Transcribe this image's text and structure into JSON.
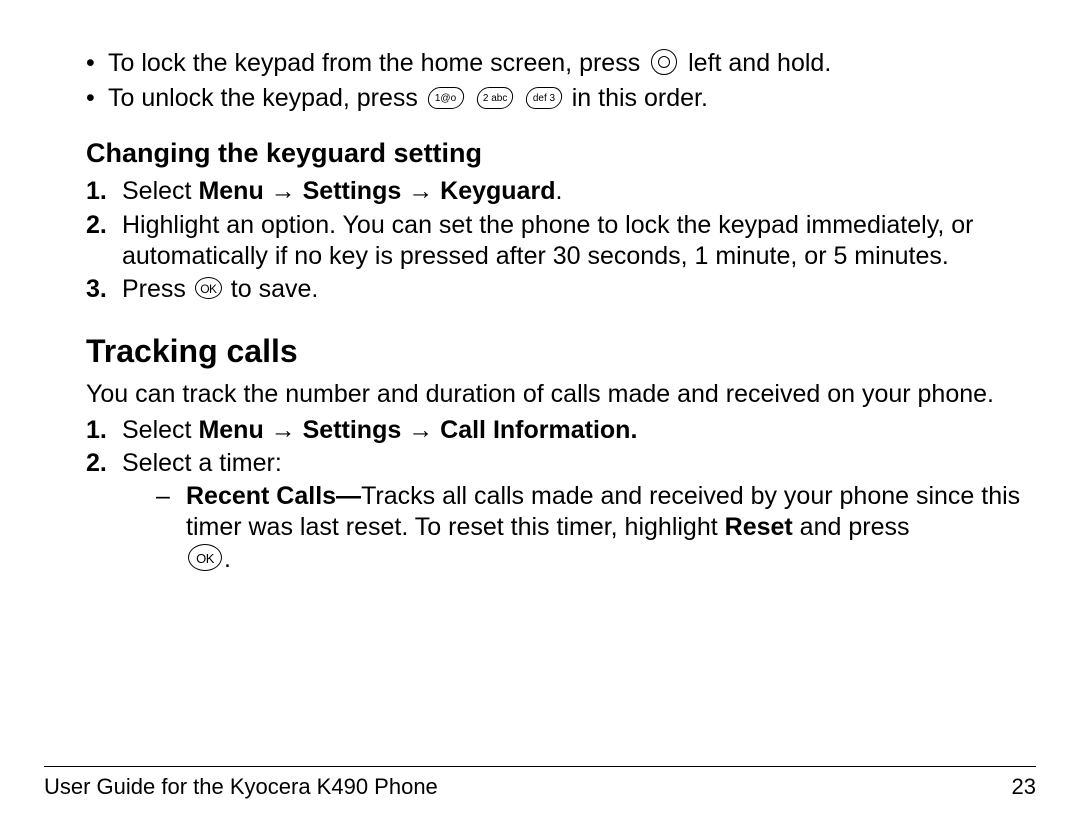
{
  "bullet1_a": "To lock the keypad from the home screen, press ",
  "bullet1_b": " left and hold.",
  "bullet2_a": "To unlock the keypad, press ",
  "bullet2_b": " in this order.",
  "key1_label": "1@o",
  "key2_label": "2 abc",
  "key3_label": "def 3",
  "heading_keyguard": "Changing the keyguard setting",
  "kg_step1_a": "Select ",
  "kg_step1_b": "Menu",
  "kg_step1_c": "Settings",
  "kg_step1_d": "Keyguard",
  "arrow": " → ",
  "period": ".",
  "kg_step2": "Highlight an option. You can set the phone to lock the keypad immediately, or automatically if no key is pressed after 30 seconds, 1 minute, or 5 minutes.",
  "kg_step3_a": "Press ",
  "kg_step3_b": " to save.",
  "ok_label": "OK",
  "heading_tracking": "Tracking calls",
  "tracking_body": "You can track the number and duration of calls made and received on your phone.",
  "tr_step1_a": "Select ",
  "tr_step1_b": "Menu",
  "tr_step1_c": "Settings",
  "tr_step1_d": "Call Information.",
  "tr_step2": "Select a timer:",
  "tr_sub_a": "Recent Calls—",
  "tr_sub_b": "Tracks all calls made and received by your phone since this timer was last reset. To reset this timer, highlight ",
  "tr_sub_c": "Reset",
  "tr_sub_d": " and press ",
  "num1": "1.",
  "num2": "2.",
  "num3": "3.",
  "dash": "–",
  "footer_left": "User Guide for the Kyocera K490 Phone",
  "footer_right": "23"
}
